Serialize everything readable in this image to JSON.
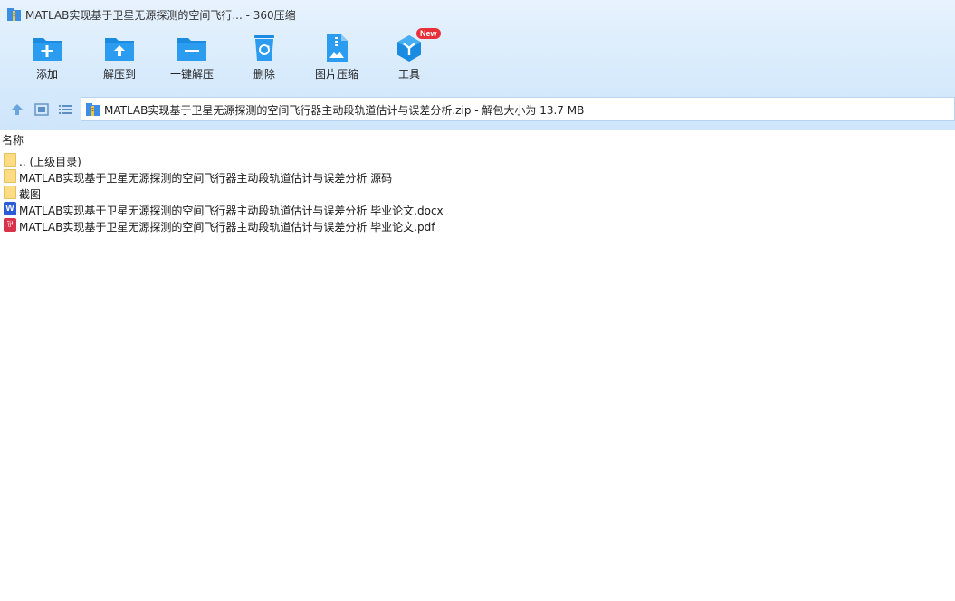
{
  "window": {
    "title": "MATLAB实现基于卫星无源探测的空间飞行... - 360压缩",
    "icon": "archive-icon"
  },
  "toolbar": {
    "items": [
      {
        "label": "添加",
        "icon": "add-folder-icon"
      },
      {
        "label": "解压到",
        "icon": "extract-to-icon"
      },
      {
        "label": "一键解压",
        "icon": "one-click-extract-icon"
      },
      {
        "label": "删除",
        "icon": "recycle-bin-icon"
      },
      {
        "label": "图片压缩",
        "icon": "image-compress-icon"
      },
      {
        "label": "工具",
        "icon": "tools-icon",
        "badge": "New"
      }
    ]
  },
  "address": {
    "path_text": "MATLAB实现基于卫星无源探测的空间飞行器主动段轨道估计与误差分析.zip - 解包大小为 13.7 MB"
  },
  "list": {
    "column_name": "名称",
    "rows": [
      {
        "name": ".. (上级目录)",
        "type": "folder"
      },
      {
        "name": "MATLAB实现基于卫星无源探测的空间飞行器主动段轨道估计与误差分析 源码",
        "type": "folder"
      },
      {
        "name": "截图",
        "type": "folder"
      },
      {
        "name": "MATLAB实现基于卫星无源探测的空间飞行器主动段轨道估计与误差分析 毕业论文.docx",
        "type": "word",
        "icon_glyph": "W"
      },
      {
        "name": "MATLAB实现基于卫星无源探测的空间飞行器主动段轨道估计与误差分析 毕业论文.pdf",
        "type": "pdf",
        "icon_glyph": "⅌"
      }
    ]
  },
  "colors": {
    "accent": "#1a8be0",
    "badge": "#e8303a",
    "folder": "#fcdd86"
  }
}
